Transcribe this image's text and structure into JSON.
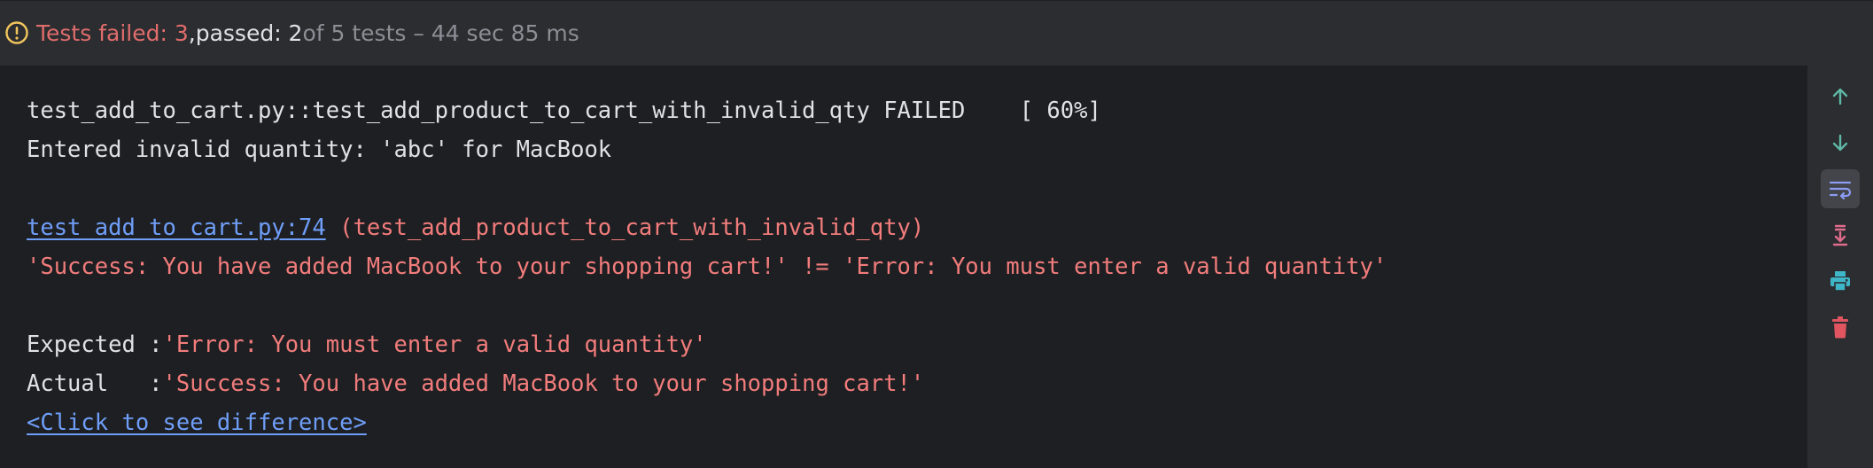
{
  "status": {
    "failed_text": "Tests failed: 3",
    "separator": ", ",
    "passed_text": "passed: 2",
    "total_text": " of 5 tests – 44 sec 85 ms"
  },
  "console": {
    "result_line": "test_add_to_cart.py::test_add_product_to_cart_with_invalid_qty FAILED    [ 60%]",
    "log_line": "Entered invalid quantity: 'abc' for MacBook",
    "trace_link": "test_add_to_cart.py:74",
    "trace_rest": " (test_add_product_to_cart_with_invalid_qty)",
    "assert_message": "'Success: You have added MacBook to your shopping cart!' != 'Error: You must enter a valid quantity'",
    "expected_label": "Expected :",
    "expected_value": "'Error: You must enter a valid quantity'",
    "actual_label": "Actual   :",
    "actual_value": "'Success: You have added MacBook to your shopping cart!'",
    "diff_link": "<Click to see difference>"
  },
  "toolbar": {
    "buttons": [
      {
        "icon": "arrow-up-icon",
        "color": "#5fb8a6"
      },
      {
        "icon": "arrow-down-icon",
        "color": "#5fb8a6"
      },
      {
        "icon": "soft-wrap-icon",
        "color": "#8c9cf2",
        "active": true
      },
      {
        "icon": "scroll-to-end-icon",
        "color": "#e06c8c"
      },
      {
        "icon": "print-icon",
        "color": "#3fb5c8"
      },
      {
        "icon": "trash-icon",
        "color": "#e05560"
      }
    ]
  },
  "colors": {
    "failed": "#e06c6c",
    "error_text": "#f27c7c",
    "link": "#6f9ef8",
    "warning": "#f2c55c"
  }
}
